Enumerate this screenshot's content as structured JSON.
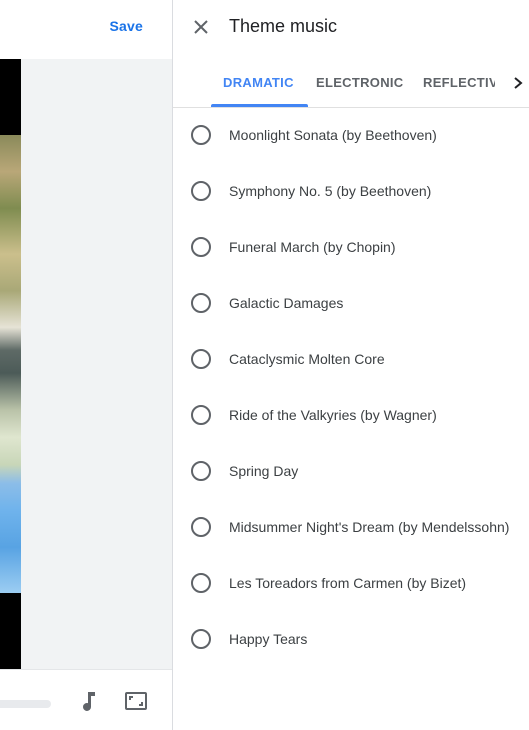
{
  "editor": {
    "save_label": "Save",
    "icons": {
      "music": "music-note-icon",
      "aspect": "aspect-ratio-icon"
    }
  },
  "panel": {
    "title": "Theme music",
    "close_icon": "close-icon",
    "tabs": [
      {
        "label": "DRAMATIC",
        "active": true
      },
      {
        "label": "ELECTRONIC",
        "active": false
      },
      {
        "label": "REFLECTIV",
        "active": false
      }
    ],
    "next_icon": "chevron-right-icon",
    "tracks": [
      {
        "label": "Moonlight Sonata (by Beethoven)",
        "selected": false
      },
      {
        "label": "Symphony No. 5 (by Beethoven)",
        "selected": false
      },
      {
        "label": "Funeral March (by Chopin)",
        "selected": false
      },
      {
        "label": "Galactic Damages",
        "selected": false
      },
      {
        "label": "Cataclysmic Molten Core",
        "selected": false
      },
      {
        "label": "Ride of the Valkyries (by Wagner)",
        "selected": false
      },
      {
        "label": "Spring Day",
        "selected": false
      },
      {
        "label": "Midsummer Night's Dream (by Mendelssohn)",
        "selected": false
      },
      {
        "label": "Les Toreadors from Carmen (by Bizet)",
        "selected": false
      },
      {
        "label": "Happy Tears",
        "selected": false
      }
    ]
  },
  "colors": {
    "accent": "#4285f4",
    "save": "#1a73e8",
    "text": "#3c4043",
    "muted": "#5f6368"
  }
}
